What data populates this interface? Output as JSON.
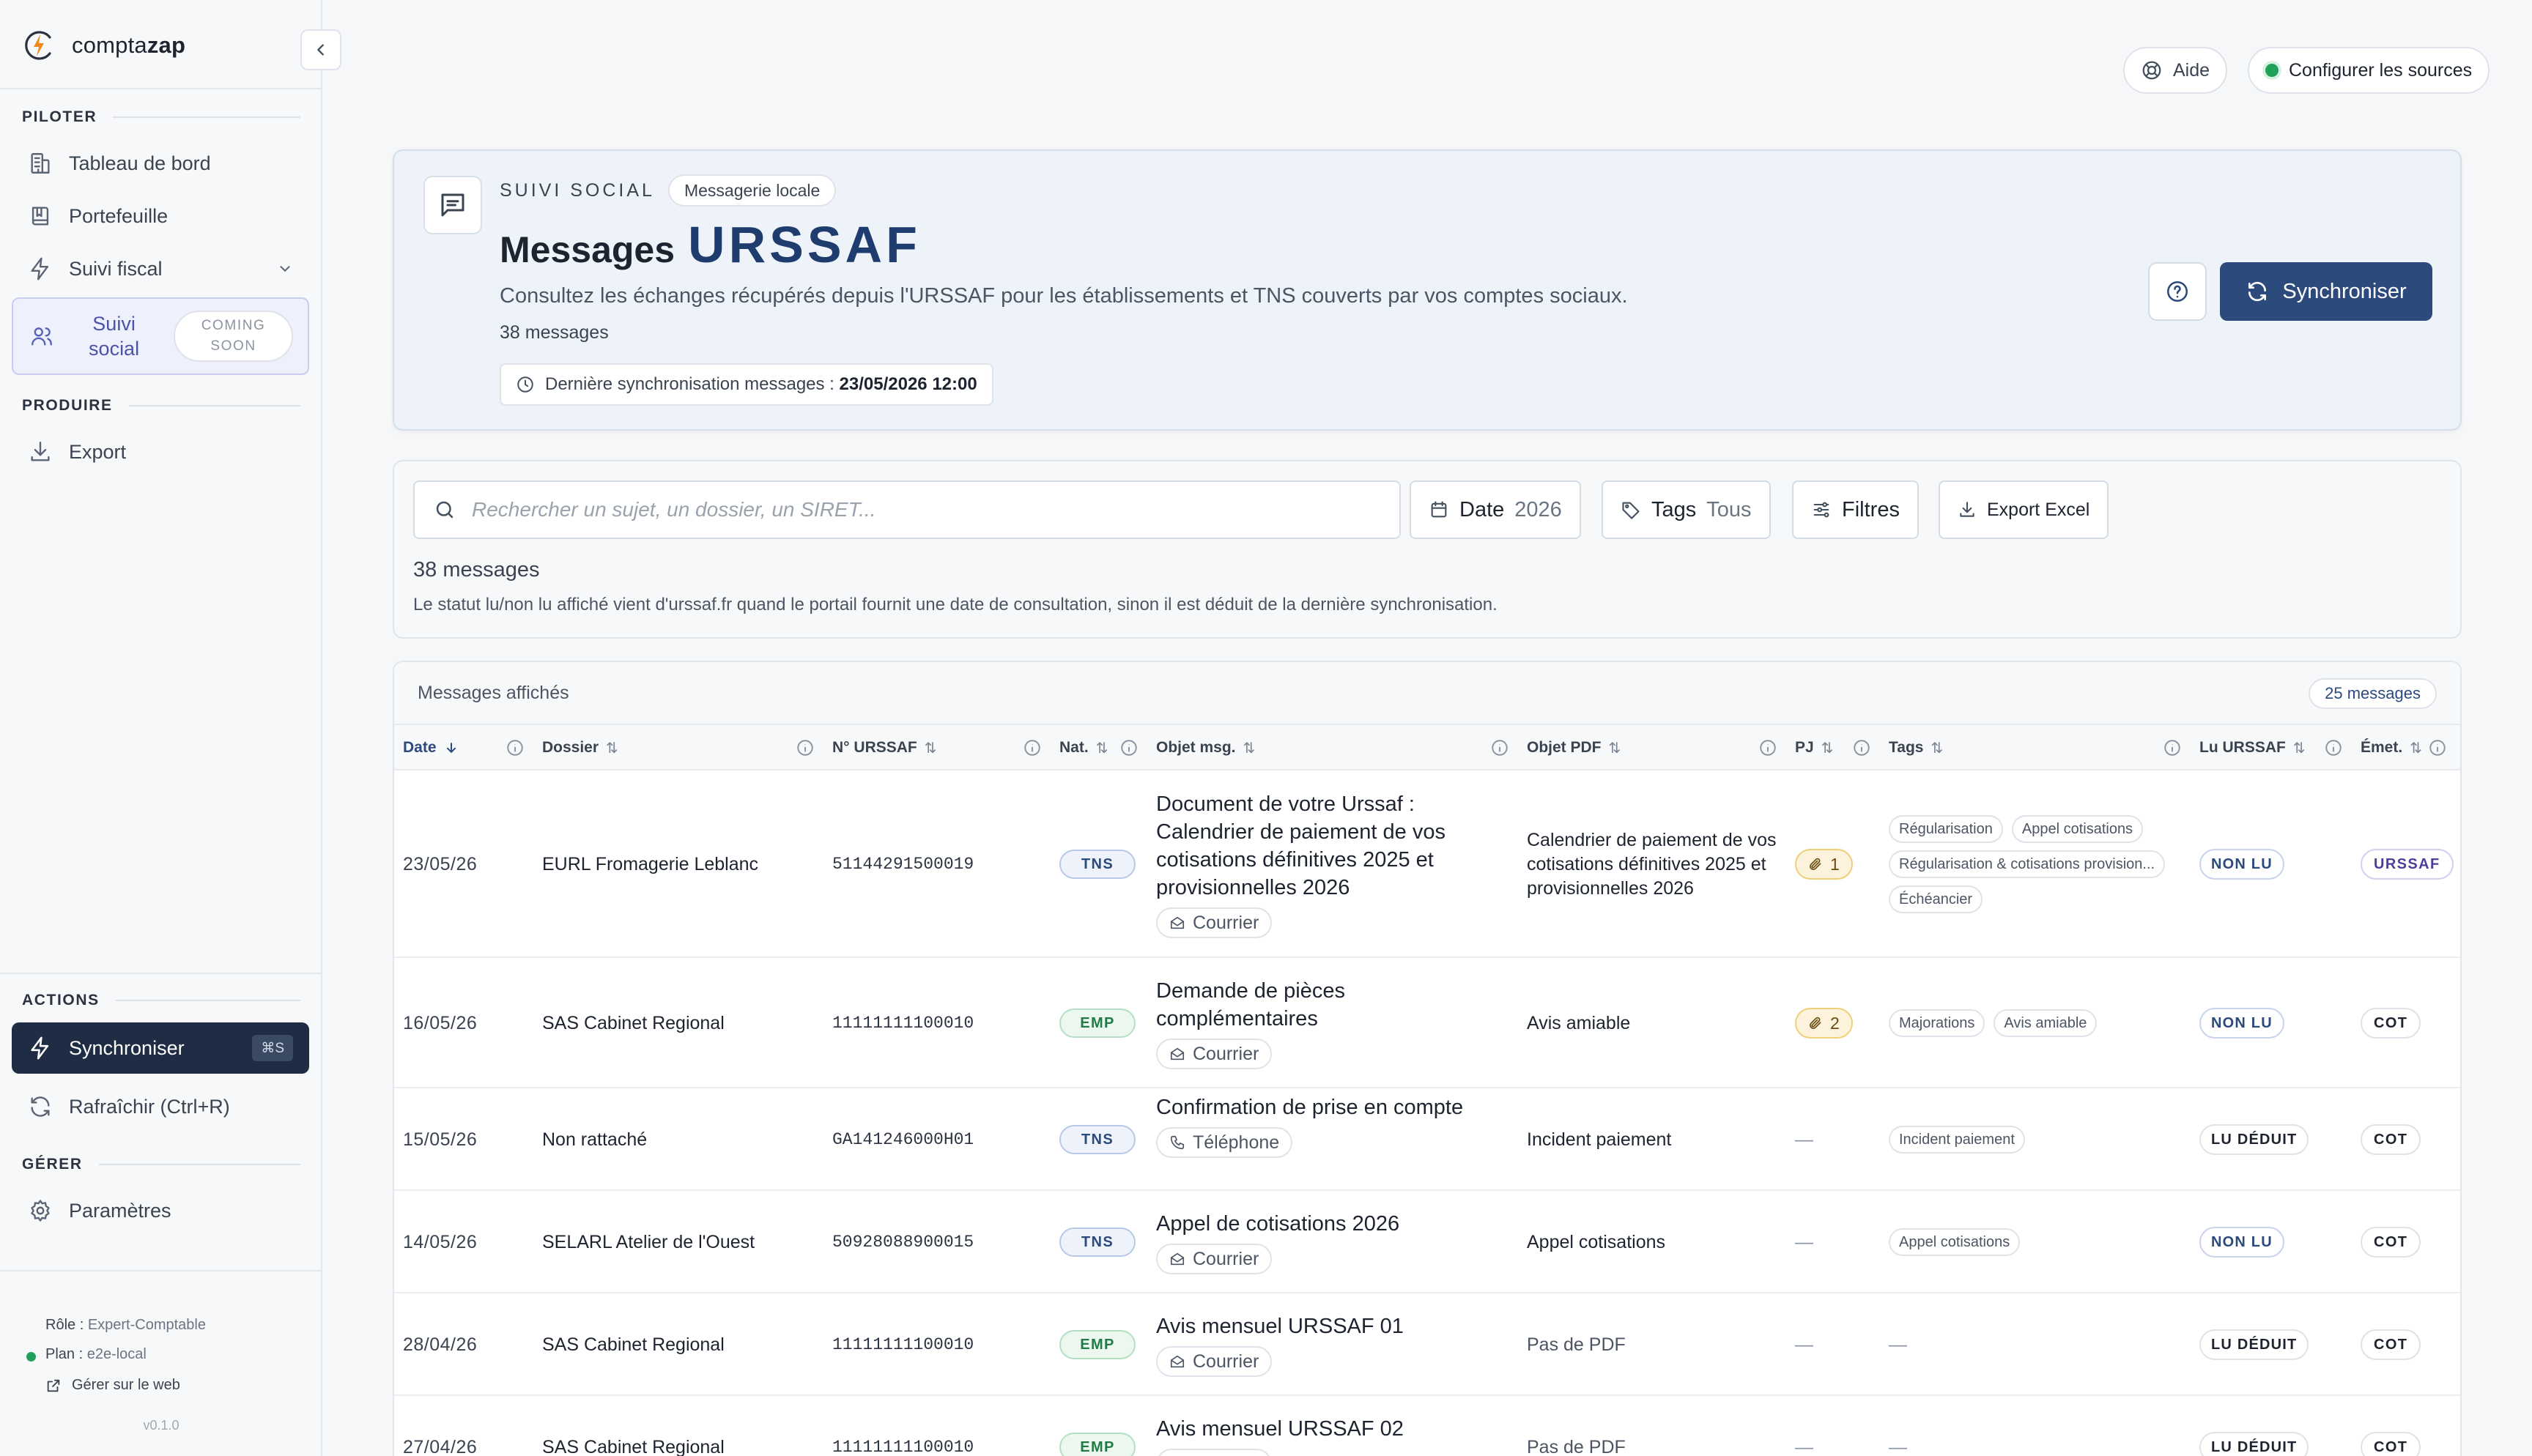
{
  "app": {
    "brand_light": "compta",
    "brand_bold": "zap"
  },
  "sidebar": {
    "sections": {
      "piloter": "PILOTER",
      "produire": "PRODUIRE",
      "actions": "ACTIONS",
      "gerer": "GÉRER"
    },
    "items": {
      "dashboard": "Tableau de bord",
      "portfolio": "Portefeuille",
      "fiscal": "Suivi fiscal",
      "social_line1": "Suivi",
      "social_line2": "social",
      "coming_line1": "COMING",
      "coming_line2": "SOON",
      "export": "Export",
      "sync": "Synchroniser",
      "sync_shortcut": "⌘S",
      "refresh": "Rafraîchir (Ctrl+R)",
      "settings": "Paramètres"
    },
    "footer": {
      "role_label": "Rôle : ",
      "role_value": "Expert-Comptable",
      "plan_label": "Plan : ",
      "plan_value": "e2e-local",
      "manage": "Gérer sur le web",
      "version": "v0.1.0"
    }
  },
  "topbar": {
    "help": "Aide",
    "sources": "Configurer les sources"
  },
  "hero": {
    "eyebrow": "SUIVI SOCIAL",
    "chip": "Messagerie locale",
    "title_prefix": "Messages",
    "title_accent": "URSSAF",
    "subtitle": "Consultez les échanges récupérés depuis l'URSSAF pour les établissements et TNS couverts par vos comptes sociaux.",
    "count": "38 messages",
    "last_sync_label": "Dernière synchronisation messages : ",
    "last_sync_value": "23/05/2026 12:00",
    "sync_button": "Synchroniser"
  },
  "filters": {
    "search_placeholder": "Rechercher un sujet, un dossier, un SIRET...",
    "date_label": "Date",
    "date_value": "2026",
    "tags_label": "Tags",
    "tags_value": "Tous",
    "filters_label": "Filtres",
    "export_label": "Export Excel",
    "count": "38 messages",
    "note": "Le statut lu/non lu affiché vient d'urssaf.fr quand le portail fournit une date de consultation, sinon il est déduit de la dernière synchronisation."
  },
  "table": {
    "title": "Messages affichés",
    "count_badge": "25 messages",
    "columns": {
      "date": "Date",
      "dossier": "Dossier",
      "urssaf": "N° URSSAF",
      "nature": "Nat.",
      "objet": "Objet msg.",
      "pdf": "Objet PDF",
      "pj": "PJ",
      "tags": "Tags",
      "lu": "Lu URSSAF",
      "emet": "Émet."
    },
    "dash": "—",
    "rows": [
      {
        "date": "23/05/26",
        "dossier": "EURL Fromagerie Leblanc",
        "urssaf": "51144291500019",
        "nature": "TNS",
        "objet": "Document de votre Urssaf : Calendrier de paiement de vos cotisations définitives 2025 et provisionnelles 2026",
        "canal": "Courrier",
        "canal_icon": "mail-icon",
        "pdf": "Calendrier de paiement de vos cotisations définitives 2025 et provisionnelles 2026",
        "pj": "1",
        "tags": [
          "Régularisation",
          "Appel cotisations",
          "Régularisation & cotisations provision...",
          "Échéancier"
        ],
        "lu": "NON LU",
        "emet": "URSSAF"
      },
      {
        "date": "16/05/26",
        "dossier": "SAS Cabinet Regional",
        "urssaf": "11111111100010",
        "nature": "EMP",
        "objet": "Demande de pièces complémentaires",
        "canal": "Courrier",
        "canal_icon": "mail-icon",
        "pdf": "Avis amiable",
        "pj": "2",
        "tags": [
          "Majorations",
          "Avis amiable"
        ],
        "lu": "NON LU",
        "emet": "COT"
      },
      {
        "date": "15/05/26",
        "dossier": "Non rattaché",
        "urssaf": "GA141246000H01",
        "nature": "TNS",
        "objet": "Confirmation de prise en compte",
        "canal": "Téléphone",
        "canal_icon": "phone-icon",
        "pdf": "Incident paiement",
        "pj": "",
        "tags": [
          "Incident paiement"
        ],
        "lu": "LU DÉDUIT",
        "emet": "COT"
      },
      {
        "date": "14/05/26",
        "dossier": "SELARL Atelier de l'Ouest",
        "urssaf": "50928088900015",
        "nature": "TNS",
        "objet": "Appel de cotisations 2026",
        "canal": "Courrier",
        "canal_icon": "mail-icon",
        "pdf": "Appel cotisations",
        "pj": "",
        "tags": [
          "Appel cotisations"
        ],
        "lu": "NON LU",
        "emet": "COT"
      },
      {
        "date": "28/04/26",
        "dossier": "SAS Cabinet Regional",
        "urssaf": "11111111100010",
        "nature": "EMP",
        "objet": "Avis mensuel URSSAF 01",
        "canal": "Courrier",
        "canal_icon": "mail-icon",
        "pdf": "Pas de PDF",
        "pj": "",
        "tags": [],
        "lu": "LU DÉDUIT",
        "emet": "COT"
      },
      {
        "date": "27/04/26",
        "dossier": "SAS Cabinet Regional",
        "urssaf": "11111111100010",
        "nature": "EMP",
        "objet": "Avis mensuel URSSAF 02",
        "canal": "Courrier",
        "canal_icon": "mail-icon",
        "pdf": "Pas de PDF",
        "pj": "",
        "tags": [],
        "lu": "LU DÉDUIT",
        "emet": "COT"
      }
    ]
  },
  "colors": {
    "navy": "#1e2c44",
    "accent": "#2c4a7c",
    "brand_orange": "#f08a1c",
    "success": "#22a05a"
  }
}
